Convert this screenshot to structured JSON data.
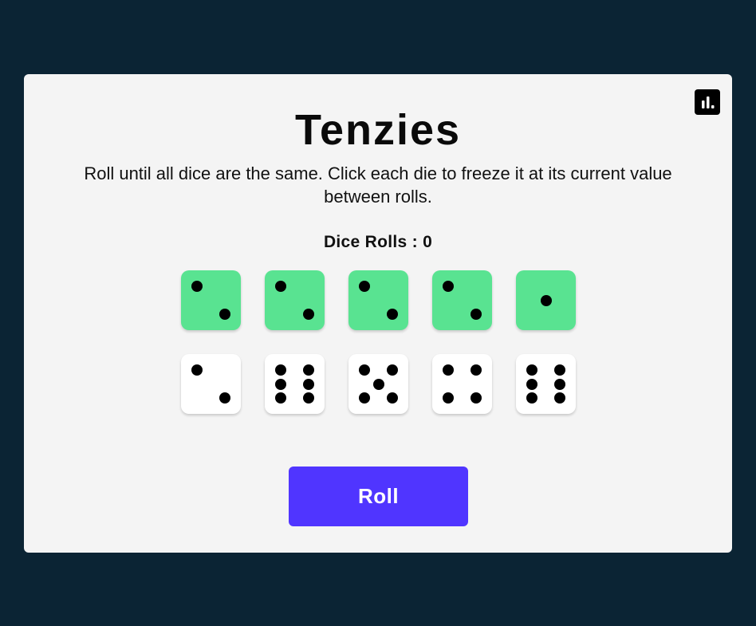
{
  "game": {
    "title": "Tenzies",
    "instructions": "Roll until all dice are the same. Click each die to freeze it at its current value between rolls.",
    "roll_count_label": "Dice Rolls : ",
    "roll_count": "0",
    "roll_button_label": "Roll",
    "stats_button_icon": "bar-chart-icon"
  },
  "colors": {
    "background": "#0b2434",
    "panel": "#f4f4f4",
    "held_die": "#59e391",
    "free_die": "#ffffff",
    "pip": "#000000",
    "roll_button": "#5035ff"
  },
  "dice": [
    {
      "value": 2,
      "held": true
    },
    {
      "value": 2,
      "held": true
    },
    {
      "value": 2,
      "held": true
    },
    {
      "value": 2,
      "held": true
    },
    {
      "value": 1,
      "held": true
    },
    {
      "value": 2,
      "held": false
    },
    {
      "value": 6,
      "held": false
    },
    {
      "value": 5,
      "held": false
    },
    {
      "value": 4,
      "held": false
    },
    {
      "value": 6,
      "held": false
    }
  ]
}
